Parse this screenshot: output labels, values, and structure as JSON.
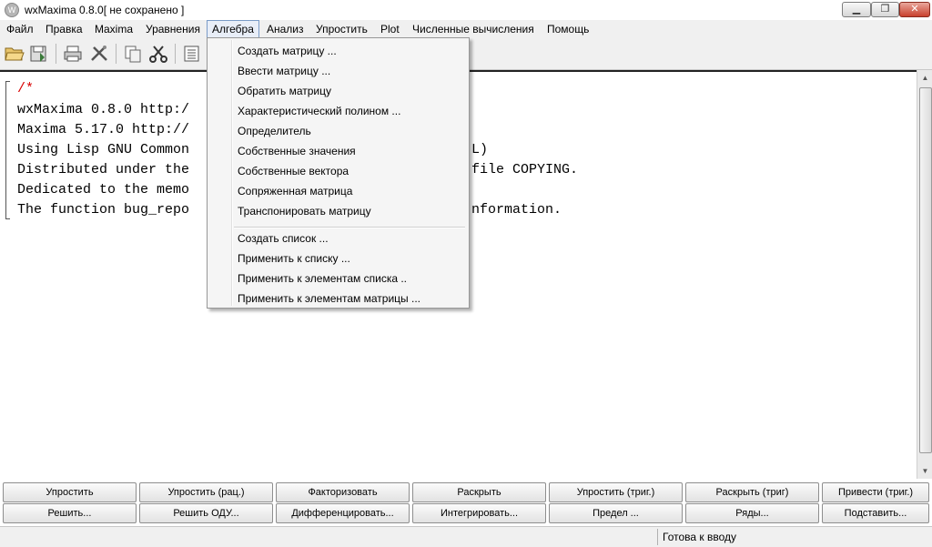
{
  "window": {
    "title": "wxMaxima 0.8.0[ не сохранено ]",
    "icon": "wxmaxima-icon",
    "controls": {
      "minimize": "minimize-icon",
      "maximize": "maximize-icon",
      "close": "close-icon"
    }
  },
  "menubar": {
    "items": [
      "Файл",
      "Правка",
      "Maxima",
      "Уравнения",
      "Алгебра",
      "Анализ",
      "Упростить",
      "Plot",
      "Численные вычисления",
      "Помощь"
    ],
    "active": "Алгебра"
  },
  "toolbar": {
    "icons": [
      "open-icon",
      "save-icon",
      "print-icon",
      "preferences-icon",
      "copy-icon",
      "cut-icon",
      "select-all-icon"
    ]
  },
  "algebra_menu": {
    "group1": [
      "Создать матрицу ...",
      "Ввести матрицу ...",
      "Обратить матрицу",
      "Характеристический полином ...",
      "Определитель",
      "Собственные значения",
      "Собственные вектора",
      "Сопряженная матрица",
      "Транспонировать матрицу"
    ],
    "group2": [
      "Создать список ...",
      "Применить к списку ...",
      "Применить к элементам списка ..",
      "Применить к элементам матрицы ..."
    ]
  },
  "editor": {
    "lines": [
      {
        "text": "/*",
        "style": "comment"
      },
      {
        "text": "wxMaxima 0.8.0 http:/",
        "style": "normal"
      },
      {
        "text": "Maxima 5.17.0 http://",
        "style": "normal"
      },
      {
        "text": "Using Lisp GNU Common",
        "style": "normal"
      },
      {
        "text": "Distributed under the",
        "style": "normal"
      },
      {
        "text": "Dedicated to the memo",
        "style": "normal"
      },
      {
        "text": "The function bug_repo",
        "style": "normal"
      }
    ],
    "hidden_fragments": [
      "L)",
      "file COPYING.",
      "nformation."
    ]
  },
  "buttons": {
    "row1": [
      "Упростить",
      "Упростить (рац.)",
      "Факторизовать",
      "Раскрыть",
      "Упростить (триг.)",
      "Раскрыть (триг)",
      "Привести (триг.)"
    ],
    "row2": [
      "Решить...",
      "Решить ОДУ...",
      "Дифференцировать...",
      "Интегрировать...",
      "Предел ...",
      "Ряды...",
      "Подставить..."
    ]
  },
  "status": {
    "text": "Готова к вводу"
  },
  "colors": {
    "comment": "#d80000",
    "menu_active_border": "#7a9bc7"
  }
}
